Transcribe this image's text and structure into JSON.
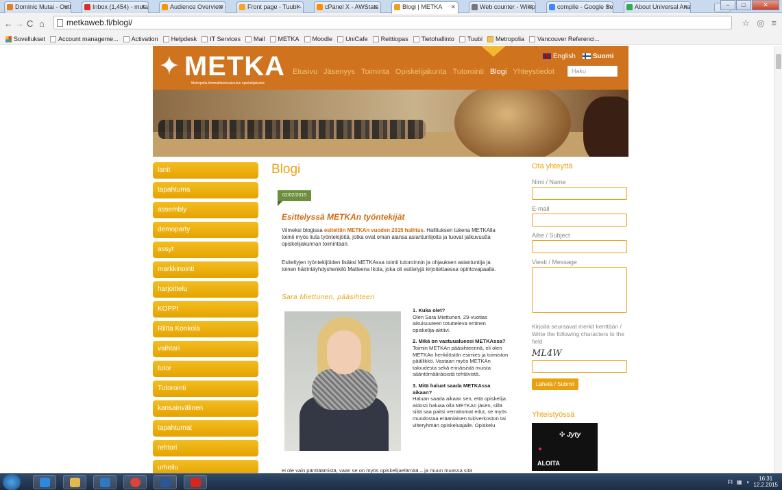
{
  "browser": {
    "tabs": [
      {
        "label": "Dominic Mutai - Outl",
        "color": "#e67e22"
      },
      {
        "label": "Inbox (1,454) - mutai",
        "color": "#d93025"
      },
      {
        "label": "Audience Overview -",
        "color": "#f29900"
      },
      {
        "label": "Front page - Tuubi -",
        "color": "#f5a623"
      },
      {
        "label": "cPanel X - AWStats",
        "color": "#ff8c00"
      },
      {
        "label": "Blogi | METKA",
        "color": "#f0a020",
        "active": true
      },
      {
        "label": "Web counter - Wikip",
        "color": "#777777"
      },
      {
        "label": "compile - Google Sea",
        "color": "#4285f4"
      },
      {
        "label": "About Universal Anal",
        "color": "#34a853"
      }
    ],
    "address": "metkaweb.fi/blogi/",
    "bookmarks": [
      {
        "label": "Sovellukset",
        "icon": "apps-icon"
      },
      {
        "label": "Account manageme...",
        "icon": "page-icon"
      },
      {
        "label": "Activation",
        "icon": "page-icon"
      },
      {
        "label": "Helpdesk",
        "icon": "page-icon"
      },
      {
        "label": "IT Services",
        "icon": "x-icon"
      },
      {
        "label": "Mail",
        "icon": "page-icon"
      },
      {
        "label": "METKA",
        "icon": "page-icon"
      },
      {
        "label": "Moodle",
        "icon": "page-icon"
      },
      {
        "label": "UniCafe",
        "icon": "page-icon"
      },
      {
        "label": "Reittiopas",
        "icon": "page-icon"
      },
      {
        "label": "Tietohallinto",
        "icon": "page-icon"
      },
      {
        "label": "Tuubi",
        "icon": "tuubi-icon"
      },
      {
        "label": "Metropolia",
        "icon": "folder-icon"
      },
      {
        "label": "Vancouver Referenci...",
        "icon": "page-icon"
      }
    ]
  },
  "site": {
    "logo": "METKA",
    "logo_tagline": "Metropolia Ammattikorkeakoulun opiskelijakunta",
    "nav": [
      "Etusivu",
      "Jäsenyys",
      "Toiminta",
      "Opiskelijakunta",
      "Tutorointi",
      "Blogi",
      "Yhteystiedot"
    ],
    "nav_active": "Blogi",
    "lang_en": "English",
    "lang_fi": "Suomi",
    "search_placeholder": "Haku",
    "categories": [
      "lanit",
      "tapahtuma",
      "assembly",
      "demoparty",
      "assyt",
      "markkinointi",
      "harjoittelu",
      "KOPPI",
      "Riitta Konkola",
      "vaihtari",
      "tutor",
      "Tutorointi",
      "kansainvälinen",
      "tapahtumat",
      "rehtori",
      "urheilu"
    ]
  },
  "post": {
    "page_title": "Blogi",
    "date": "02/02/2015",
    "title": "Esittelyssä METKAn työntekijät",
    "intro_before": "Viimeksi blogissa ",
    "intro_link": "esiteltiin METKAn vuoden 2015 hallitus",
    "intro_after": ". Hallituksen tukena METKAlla toimii myös liuta työntekijöitä, jotka ovat oman alansa asiantuntijoita ja tuovat jatkuvuutta opiskelijakunnan toimintaan.",
    "para2": "Esiteltyjen työntekijöiden lisäksi METKAssa toimii tutoroinnin ja ohjauksen asiantuntija ja toinen häirintäyhdyshenkilö Matleena Ikola, joka oli esittelyjä kirjoitettaessa opintovapaalla.",
    "subheading": "Sara Miettunen, pääsihteeri",
    "qa": [
      {
        "q": "1. Kuka olet?",
        "a": "Olen Sara Miettunen, 29-vuotias aikuisuuteen totutteleva entinen opiskelija-aktiivi."
      },
      {
        "q": "2. Mikä on vastuualueesi METKAssa?",
        "a": "Toimin METKAn pääsihteerinä, eli olen METKAn henkilöstön esimies ja toimiston päällikkö. Vastaan myös METKAn taloudesta sekä erinäisistä muista sääntömääräisistä tehtävistä."
      },
      {
        "q": "3. Mitä haluat saada METKAssa aikaan?",
        "a": "Haluan saada aikaan sen, että opiskelija aidosti haluaa olla METKAn jäsen, sillä siitä saa paitsi verrattomat edut, se myös muodostaa eräänlaisen tukiverkoston tai viiteryhmän opiskeluajalle. Opiskelu"
      }
    ],
    "bottom_line": "ei ole vain pänttäämistä, vaan se on myös opiskelijaelämää – ja muun muassa sitä"
  },
  "contact": {
    "heading": "Ota yhteyttä",
    "name_label": "Nimi / Name",
    "email_label": "E-mail",
    "subject_label": "Aihe / Subject",
    "message_label": "Viesti / Message",
    "captcha_note": "Kirjoita seuraavat merkit kenttään / Write the following characters to the field",
    "captcha": "ML4W",
    "submit": "Lähetä / Submit",
    "partners_heading": "Yhteistyössä",
    "partner_name": "Jyty",
    "partner_cta": "ALOITA"
  },
  "taskbar": {
    "time": "16:31",
    "date": "12.2.2015",
    "lang": "FI"
  }
}
